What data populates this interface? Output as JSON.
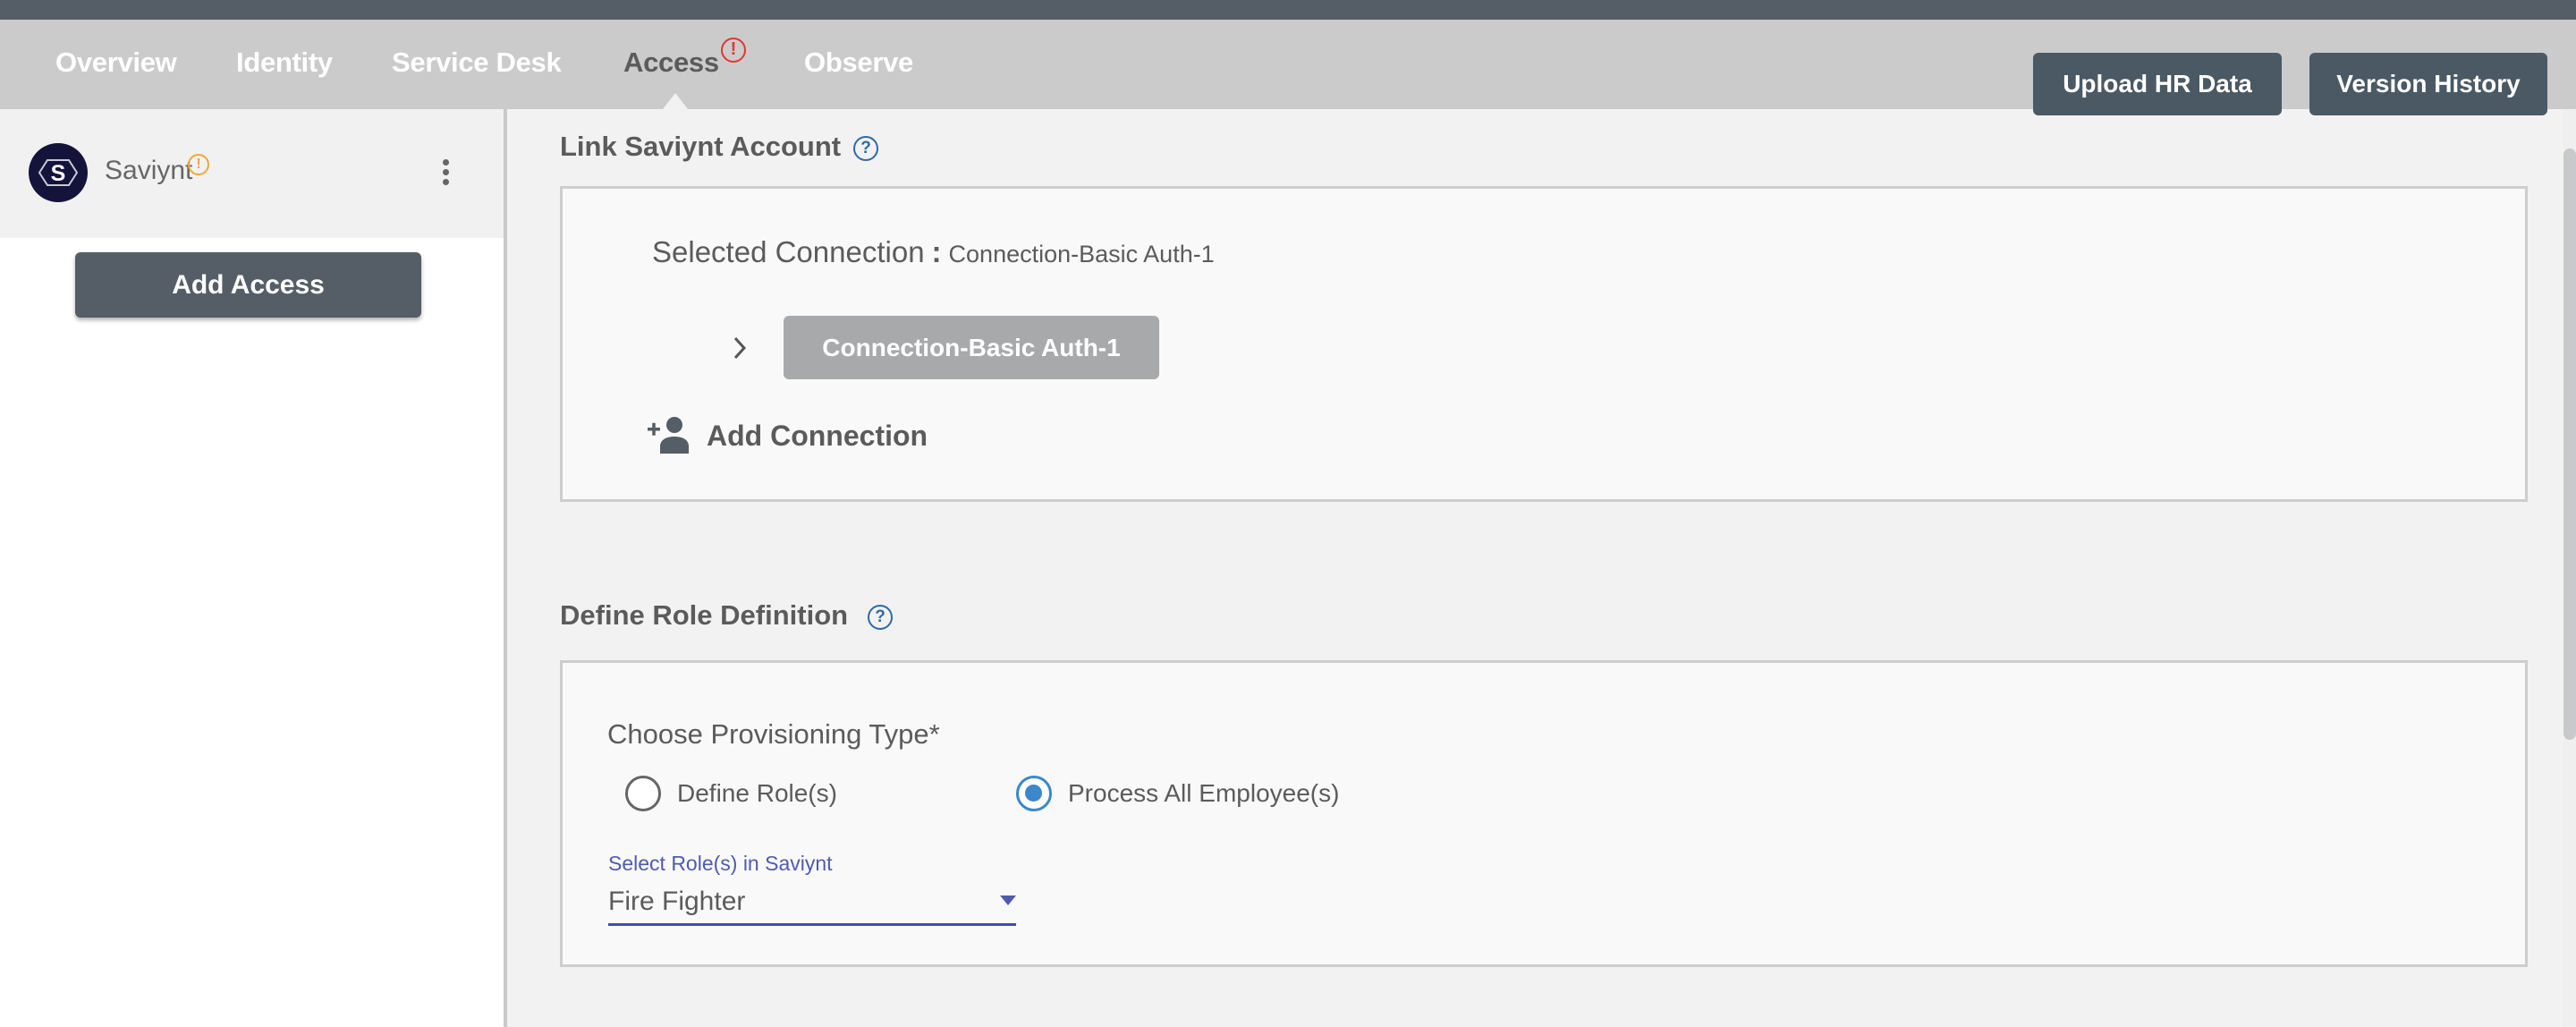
{
  "nav": {
    "tabs": [
      {
        "label": "Overview",
        "active": false
      },
      {
        "label": "Identity",
        "active": false
      },
      {
        "label": "Service Desk",
        "active": false
      },
      {
        "label": "Access",
        "active": true,
        "alert": "!"
      },
      {
        "label": "Observe",
        "active": false
      }
    ],
    "upload_label": "Upload HR Data",
    "history_label": "Version History"
  },
  "sidebar": {
    "app": {
      "logo_letter": "S",
      "name": "Saviynt",
      "warning": "!"
    },
    "add_access_label": "Add Access"
  },
  "link_section": {
    "title": "Link Saviynt Account",
    "help": "?",
    "selected_label": "Selected Connection",
    "separator": ":",
    "selected_value": "Connection-Basic Auth-1",
    "connections": [
      "Connection-Basic Auth-1"
    ],
    "add_connection_label": "Add Connection"
  },
  "role_section": {
    "title": "Define Role Definition",
    "help": "?",
    "provisioning_label": "Choose Provisioning Type*",
    "options": [
      {
        "label": "Define Role(s)",
        "checked": false
      },
      {
        "label": "Process All Employee(s)",
        "checked": true
      }
    ],
    "select_label": "Select Role(s) in Saviynt",
    "select_value": "Fire Fighter"
  },
  "colors": {
    "accent_blue": "#3b87c9",
    "select_indigo": "#3f4eb0",
    "alert_red": "#e0392b",
    "warning_orange": "#f0a735",
    "button_dark": "#4a5964"
  }
}
